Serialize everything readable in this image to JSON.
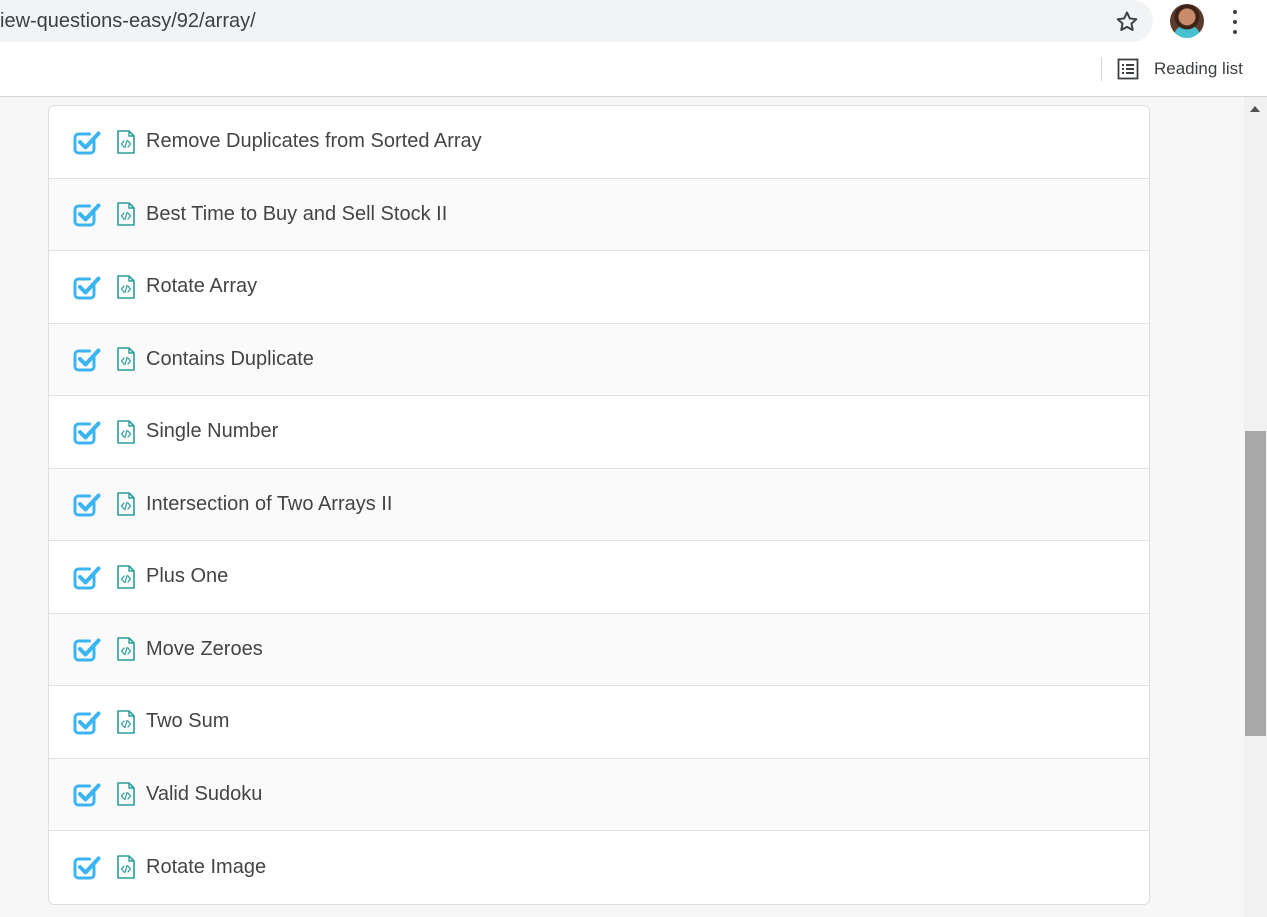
{
  "browser": {
    "url": "iew-questions-easy/92/array/",
    "bookmark_icon": "star-icon",
    "menu_icon": "vertical-dots-icon",
    "reading_list_label": "Reading list"
  },
  "questions": [
    {
      "title": "Remove Duplicates from Sorted Array",
      "completed": true
    },
    {
      "title": "Best Time to Buy and Sell Stock II",
      "completed": true
    },
    {
      "title": "Rotate Array",
      "completed": true
    },
    {
      "title": "Contains Duplicate",
      "completed": true
    },
    {
      "title": "Single Number",
      "completed": true
    },
    {
      "title": "Intersection of Two Arrays II",
      "completed": true
    },
    {
      "title": "Plus One",
      "completed": true
    },
    {
      "title": "Move Zeroes",
      "completed": true
    },
    {
      "title": "Two Sum",
      "completed": true
    },
    {
      "title": "Valid Sudoku",
      "completed": true
    },
    {
      "title": "Rotate Image",
      "completed": true
    }
  ],
  "colors": {
    "check": "#3ab4f2",
    "file_icon": "#2a9d9a",
    "text": "#444444"
  }
}
